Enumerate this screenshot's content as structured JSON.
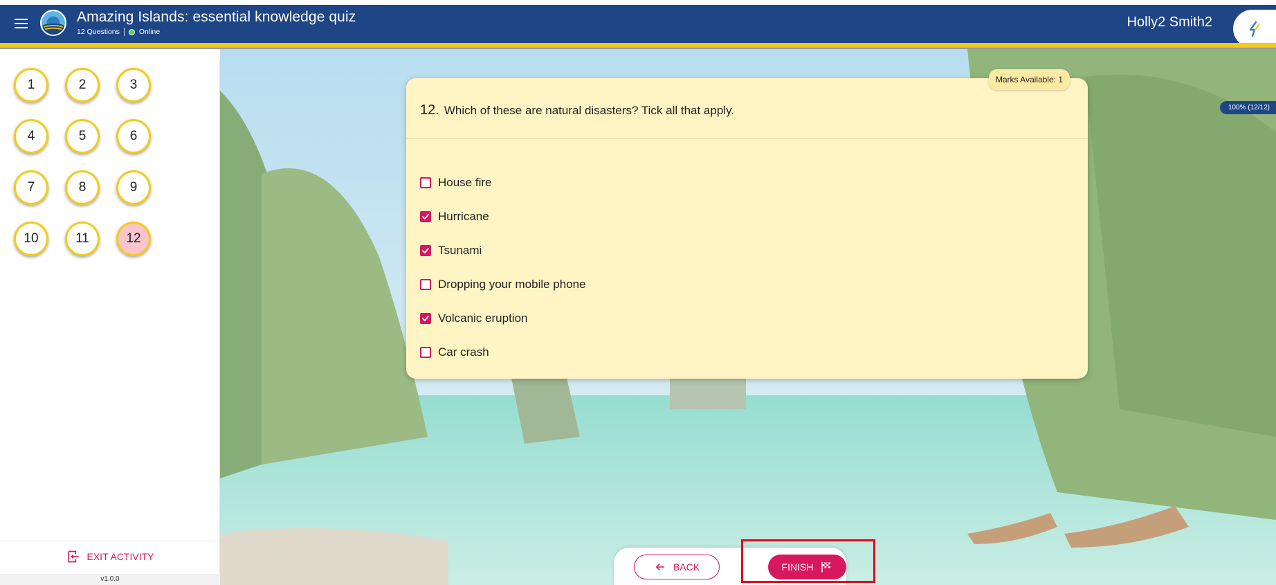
{
  "header": {
    "title": "Amazing Islands: essential knowledge quiz",
    "question_count": "12 Questions",
    "status": "Online",
    "username": "Holly2 Smith2"
  },
  "progress": "100% (12/12)",
  "sidebar": {
    "questions": [
      "1",
      "2",
      "3",
      "4",
      "5",
      "6",
      "7",
      "8",
      "9",
      "10",
      "11",
      "12"
    ],
    "current": "12",
    "exit_label": "EXIT ACTIVITY",
    "version": "v1.0.0"
  },
  "question": {
    "number": "12.",
    "text": "Which of these are natural disasters? Tick all that apply.",
    "marks": "Marks Available: 1",
    "options": [
      {
        "label": "House fire",
        "checked": false
      },
      {
        "label": "Hurricane",
        "checked": true
      },
      {
        "label": "Tsunami",
        "checked": true
      },
      {
        "label": "Dropping your mobile phone",
        "checked": false
      },
      {
        "label": "Volcanic eruption",
        "checked": true
      },
      {
        "label": "Car crash",
        "checked": false
      }
    ]
  },
  "nav": {
    "back_label": "BACK",
    "finish_label": "FINISH"
  },
  "colors": {
    "header_blue": "#1e4585",
    "accent_yellow": "#f2cb16",
    "accent_pink": "#d8185e",
    "card_bg": "#fff4c4"
  },
  "icons": {
    "menu": "menu-icon",
    "exit": "exit-icon",
    "back": "arrow-left-icon",
    "finish": "checkered-flag-icon",
    "checkbox": "checkmark-icon"
  }
}
